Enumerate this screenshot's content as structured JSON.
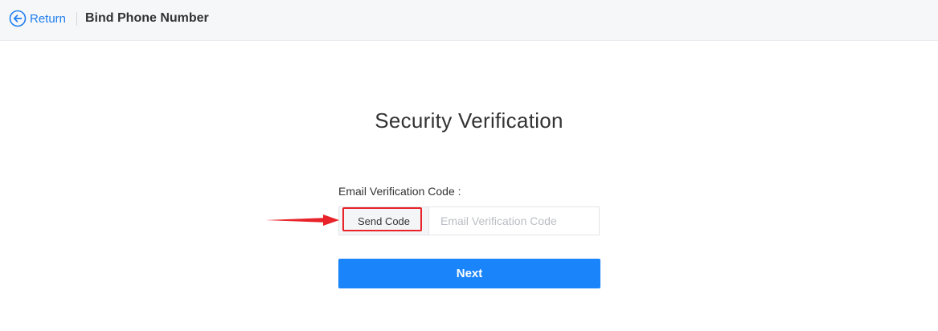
{
  "header": {
    "return_label": "Return",
    "page_title": "Bind Phone Number",
    "return_icon": "circle-arrow-left-icon"
  },
  "main": {
    "title": "Security Verification",
    "email_code_label": "Email Verification Code :",
    "send_code_label": "Send Code",
    "email_code_placeholder": "Email Verification Code",
    "email_code_value": "",
    "next_label": "Next"
  },
  "colors": {
    "accent": "#1a84fa",
    "link": "#1f7ef0",
    "highlight": "#e8232a",
    "topbar_bg": "#f6f7f9"
  },
  "annotations": {
    "arrow_icon": "red-arrow-right-icon"
  }
}
